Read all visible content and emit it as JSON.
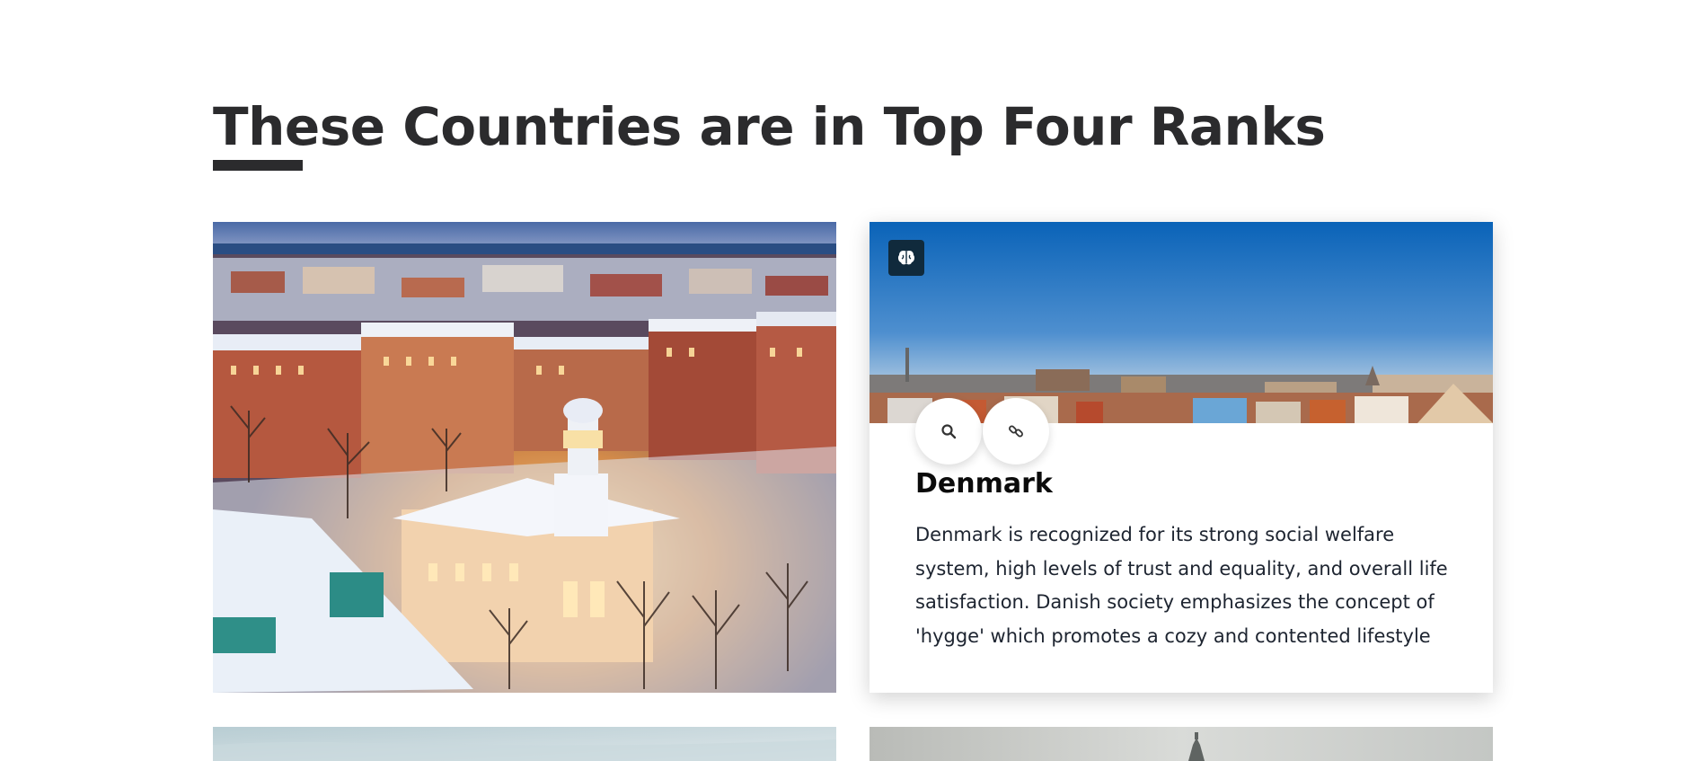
{
  "section": {
    "heading": "These Countries are in Top Four Ranks"
  },
  "cards": [
    {
      "id": "finland",
      "image": "snowy-city-aerial-photo"
    },
    {
      "id": "denmark",
      "image": "city-skyline-photo",
      "badge_icon": "brain-icon",
      "actions": [
        {
          "icon": "search-icon"
        },
        {
          "icon": "link-icon"
        }
      ],
      "title": "Denmark",
      "description": "Denmark is recognized for its strong social welfare system, high levels of trust and equality, and overall life satisfaction. Danish society emphasizes the concept of 'hygge' which promotes a cozy and contented lifestyle"
    },
    {
      "id": "card-3",
      "image": "overcast-landscape-photo"
    },
    {
      "id": "card-4",
      "image": "tower-landscape-photo"
    }
  ],
  "colors": {
    "heading": "#2b2b2d",
    "badge_bg": "#102a3c",
    "text": "#1d2430"
  }
}
